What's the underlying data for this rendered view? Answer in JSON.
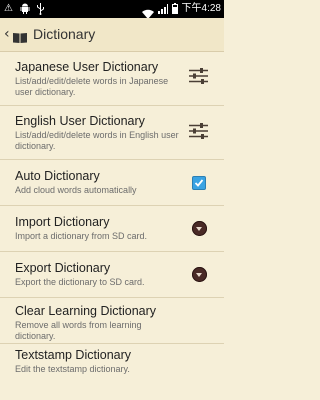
{
  "status_bar": {
    "time": "下午4:28",
    "icons": [
      "warning-icon",
      "android-icon",
      "usb-icon",
      "wifi-icon",
      "signal-icon",
      "battery-icon"
    ],
    "battery_level_percent": 70
  },
  "action_bar": {
    "back_glyph": "‹",
    "icon": "dictionary-book-icon",
    "title": "Dictionary"
  },
  "items": [
    {
      "title": "Japanese User Dictionary",
      "subtitle": "List/add/edit/delete words in Japanese user dictionary.",
      "widget": "sliders-icon"
    },
    {
      "title": "English User Dictionary",
      "subtitle": "List/add/edit/delete words in English user dictionary.",
      "widget": "sliders-icon"
    },
    {
      "title": "Auto Dictionary",
      "subtitle": "Add cloud words automatically",
      "widget": "checkbox",
      "checked": true
    },
    {
      "title": "Import Dictionary",
      "subtitle": "Import a dictionary from SD card.",
      "widget": "dropdown-circle-icon"
    },
    {
      "title": "Export Dictionary",
      "subtitle": "Export the dictionary to SD card.",
      "widget": "dropdown-circle-icon"
    },
    {
      "title": "Clear Learning Dictionary",
      "subtitle": "Remove all words from learning dictionary.",
      "widget": null
    },
    {
      "title": "Textstamp Dictionary",
      "subtitle": "Edit the textstamp dictionary.",
      "widget": null
    }
  ],
  "colors": {
    "background": "#f6efd8",
    "action_bar": "#f1e7c8",
    "checkbox": "#3aa3e3",
    "round_button": "#4a2a26"
  }
}
